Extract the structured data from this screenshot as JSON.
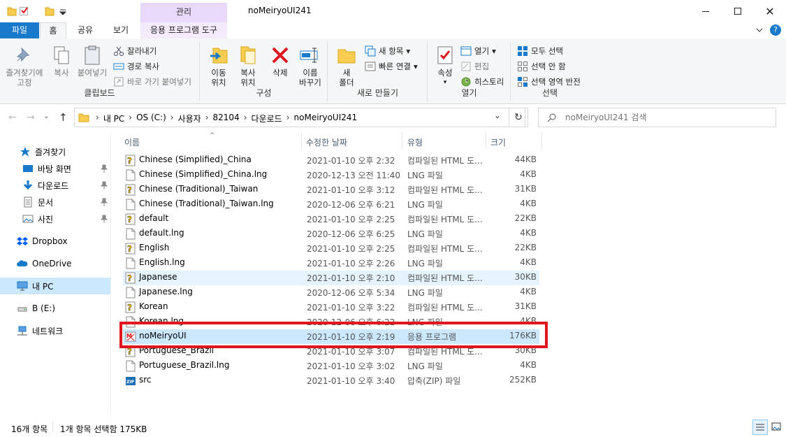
{
  "window": {
    "title": "noMeiryoUI241",
    "context_tab_group": "관리"
  },
  "tabs": [
    {
      "label": "파일",
      "active": false,
      "file": true
    },
    {
      "label": "홈",
      "active": true
    },
    {
      "label": "공유",
      "active": false
    },
    {
      "label": "보기",
      "active": false
    },
    {
      "label": "응용 프로그램 도구",
      "active": false
    }
  ],
  "ribbon": {
    "clipboard": {
      "label": "클립보드",
      "pin": "즐겨찾기에\n고정",
      "copy": "복사",
      "paste": "붙여넣기",
      "cut": "잘라내기",
      "copy_path": "경로 복사",
      "paste_shortcut": "바로 가기 붙여넣기"
    },
    "organize": {
      "label": "구성",
      "move": "이동\n위치",
      "copyto": "복사\n위치",
      "delete": "삭제",
      "rename": "이름\n바꾸기"
    },
    "new": {
      "label": "새로 만들기",
      "folder": "새\n폴더",
      "new_item": "새 항목",
      "easy_access": "빠른 연결"
    },
    "open": {
      "label": "열기",
      "properties": "속성",
      "open": "열기",
      "edit": "편집",
      "history": "히스토리"
    },
    "select": {
      "label": "선택",
      "select_all": "모두 선택",
      "select_none": "선택 안 함",
      "invert": "선택 영역 반전"
    }
  },
  "address": {
    "crumbs": [
      "내 PC",
      "OS (C:)",
      "사용자",
      "82104",
      "다운로드",
      "noMeiryoUI241"
    ],
    "search_placeholder": "noMeiryoUI241 검색"
  },
  "nav": {
    "quick_access": "즐겨찾기",
    "pinned": [
      "바탕 화면",
      "다운로드",
      "문서",
      "사진"
    ],
    "dropbox": "Dropbox",
    "onedrive": "OneDrive",
    "thispc": "내 PC",
    "drive": "B (E:)",
    "network": "네트워크"
  },
  "columns": {
    "name": "이름",
    "date": "수정한 날짜",
    "type": "유형",
    "size": "크기"
  },
  "files": [
    {
      "name": "Chinese (Simplified)_China",
      "date": "2021-01-10 오후 2:32",
      "type": "컴파일된 HTML 도...",
      "size": "44KB",
      "icon": "chm"
    },
    {
      "name": "Chinese (Simplified)_China.lng",
      "date": "2020-12-13 오전 11:40",
      "type": "LNG 파일",
      "size": "4KB",
      "icon": "doc"
    },
    {
      "name": "Chinese (Traditional)_Taiwan",
      "date": "2021-01-10 오후 3:12",
      "type": "컴파일된 HTML 도...",
      "size": "31KB",
      "icon": "chm"
    },
    {
      "name": "Chinese (Traditional)_Taiwan.lng",
      "date": "2020-12-06 오후 6:21",
      "type": "LNG 파일",
      "size": "4KB",
      "icon": "doc"
    },
    {
      "name": "default",
      "date": "2021-01-10 오후 2:25",
      "type": "컴파일된 HTML 도...",
      "size": "22KB",
      "icon": "chm"
    },
    {
      "name": "default.lng",
      "date": "2020-12-06 오후 6:25",
      "type": "LNG 파일",
      "size": "4KB",
      "icon": "doc"
    },
    {
      "name": "English",
      "date": "2021-01-10 오후 2:25",
      "type": "컴파일된 HTML 도...",
      "size": "22KB",
      "icon": "chm"
    },
    {
      "name": "English.lng",
      "date": "2021-01-10 오후 2:26",
      "type": "LNG 파일",
      "size": "4KB",
      "icon": "doc"
    },
    {
      "name": "Japanese",
      "date": "2021-01-10 오후 2:10",
      "type": "컴파일된 HTML 도...",
      "size": "30KB",
      "icon": "chm"
    },
    {
      "name": "Japanese.lng",
      "date": "2020-12-06 오후 5:34",
      "type": "LNG 파일",
      "size": "4KB",
      "icon": "doc"
    },
    {
      "name": "Korean",
      "date": "2021-01-10 오후 3:22",
      "type": "컴파일된 HTML 도...",
      "size": "31KB",
      "icon": "chm"
    },
    {
      "name": "Korean.lng",
      "date": "2020-12-06 오후 6:22",
      "type": "LNG 파일",
      "size": "4KB",
      "icon": "doc"
    },
    {
      "name": "noMeiryoUI",
      "date": "2021-01-10 오후 2:19",
      "type": "응용 프로그램",
      "size": "176KB",
      "icon": "exe"
    },
    {
      "name": "Portuguese_Brazil",
      "date": "2021-01-10 오후 3:07",
      "type": "컴파일된 HTML 도...",
      "size": "30KB",
      "icon": "chm"
    },
    {
      "name": "Portuguese_Brazil.lng",
      "date": "2021-01-10 오후 3:02",
      "type": "LNG 파일",
      "size": "4KB",
      "icon": "doc"
    },
    {
      "name": "src",
      "date": "2021-01-10 오후 3:40",
      "type": "압축(ZIP) 파일",
      "size": "252KB",
      "icon": "zip"
    }
  ],
  "status": {
    "count": "16개 항목",
    "selection": "1개 항목 선택함 175KB"
  },
  "colors": {
    "accent": "#0078d7",
    "selected_row": "#cce8ff",
    "hover_row": "#e5f3ff",
    "highlight_box": "#e0161e",
    "context_tab": "#e8d9fa"
  }
}
